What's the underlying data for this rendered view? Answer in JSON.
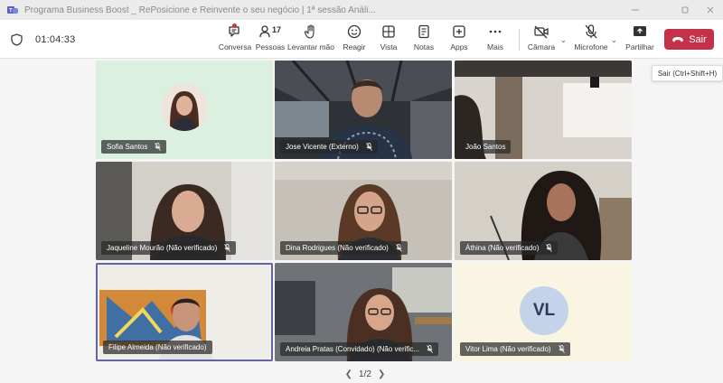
{
  "window": {
    "title": "Programa Business Boost _ RePosicione e Reinvente o seu negócio | 1ª sessão   Análi..."
  },
  "meeting": {
    "elapsed": "01:04:33"
  },
  "toolbar": {
    "chat": "Conversa",
    "people": "Pessoas",
    "people_count": "17",
    "raise_hand": "Levantar mão",
    "react": "Reagir",
    "view": "Vista",
    "notes": "Notas",
    "apps": "Apps",
    "more": "Mais",
    "camera": "Câmara",
    "mic": "Microfone",
    "share": "Partilhar",
    "leave": "Sair"
  },
  "tooltip": "Sair (Ctrl+Shift+H)",
  "participants": [
    {
      "name": "Sofia Santos"
    },
    {
      "name": "Jose Vicente (Externo)"
    },
    {
      "name": "João Santos"
    },
    {
      "name": "Jaqueline Mourão (Não verificado)"
    },
    {
      "name": "Dina Rodrigues (Não verificado)"
    },
    {
      "name": "Áthina (Não verificado)"
    },
    {
      "name": "Filipe Almeida (Não verificado)"
    },
    {
      "name": "Andreia Pratas (Convidado) (Não verific..."
    },
    {
      "name": "Vitor Lima (Não verificado)",
      "initials": "VL"
    }
  ],
  "pager": {
    "label": "1/2"
  },
  "colors": {
    "leave": "#c4314b",
    "active_speaker": "#6264a7",
    "notification": "#d13438"
  }
}
